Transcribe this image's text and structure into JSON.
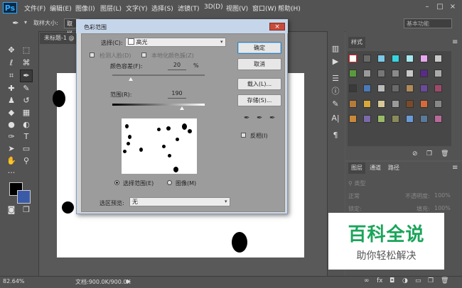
{
  "app": {
    "logo": "Ps",
    "menu": [
      "文件(F)",
      "编辑(E)",
      "图像(I)",
      "图层(L)",
      "文字(Y)",
      "选择(S)",
      "滤镜(T)",
      "3D(D)",
      "视图(V)",
      "窗口(W)",
      "帮助(H)"
    ],
    "window_controls": [
      "–",
      "□",
      "×"
    ]
  },
  "options_bar": {
    "sample_size_label": "取样大小:",
    "sample_size_value": "取样",
    "workspace": "基本功能"
  },
  "document": {
    "tab_label": "未标题-1 @ 8",
    "zoom": "82.64%",
    "doc_info": "文档:900.0K/900.0K"
  },
  "dialog": {
    "title": "色彩范围",
    "close": "×",
    "select_label": "选择(C):",
    "select_value": "高光",
    "detect_faces": "检测人脸(D)",
    "localized": "本地化颜色簇(Z)",
    "fuzziness_label": "颜色容差(F):",
    "fuzziness_value": "20",
    "fuzziness_unit": "%",
    "range_label": "范围(R):",
    "range_value": "190",
    "radio_selection": "选择范围(E)",
    "radio_image": "图像(M)",
    "preview_label": "选区预览:",
    "preview_value": "无",
    "buttons": {
      "ok": "确定",
      "cancel": "取消",
      "load": "载入(L)...",
      "save": "存储(S)..."
    },
    "invert": "反相(I)",
    "fuzziness_fraction": 0.2,
    "range_fraction": 0.75
  },
  "right_panel": {
    "styles_tab": "样式",
    "layers_tabs": [
      "图层",
      "通道",
      "路径"
    ],
    "kind": "类型",
    "blend_mode": "正常",
    "opacity_label": "不透明度:",
    "opacity_value": "100%",
    "lock_label": "锁定:",
    "fill_label": "填充:",
    "fill_value": "100%"
  },
  "watermark": {
    "title": "百科全说",
    "subtitle": "助你轻松解决"
  },
  "colors": {
    "foreground": "#000000",
    "background": "#3b5ba8"
  }
}
